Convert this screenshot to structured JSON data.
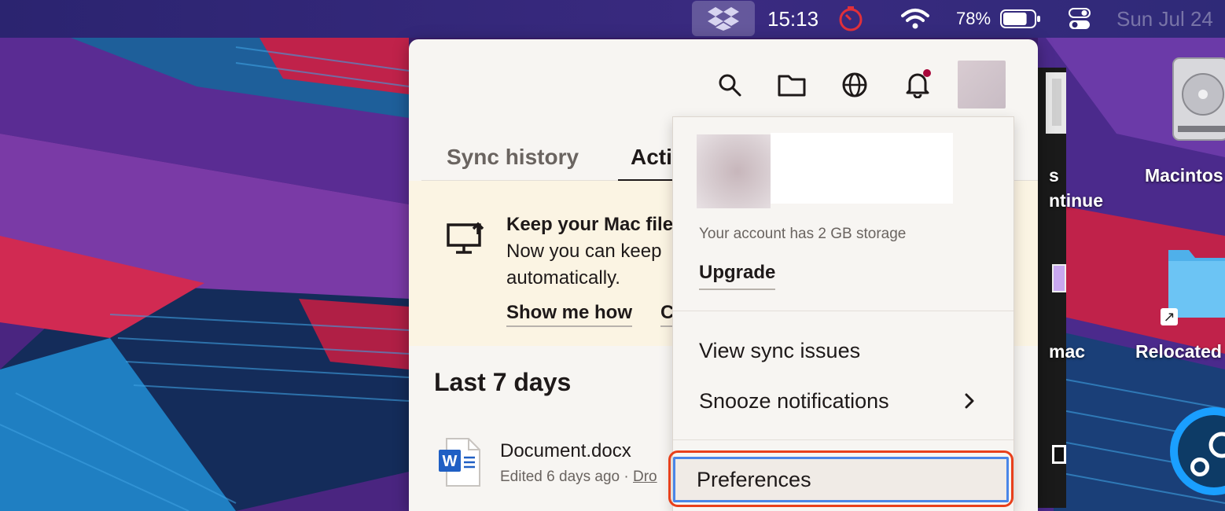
{
  "menubar": {
    "time": "15:13",
    "battery_percent": "78%",
    "date": "Sun Jul 24",
    "battery_level": 0.78
  },
  "desktop": {
    "icons": [
      {
        "label": "Macintos"
      },
      {
        "label": "Relocated"
      },
      {
        "label": "s"
      },
      {
        "label": "ntinue"
      },
      {
        "label": "mac"
      }
    ]
  },
  "popover": {
    "tabs": [
      {
        "label": "Sync history"
      },
      {
        "label": "Acti"
      }
    ],
    "banner": {
      "title": "Keep your Mac file",
      "line1": "Now you can keep",
      "line2": "automatically.",
      "link_show": "Show me how",
      "link_other": "C"
    },
    "section_title": "Last 7 days",
    "file": {
      "name": "Document.docx",
      "meta": "Edited 6 days ago · ",
      "meta_link": "Dro"
    }
  },
  "account_menu": {
    "storage_text": "Your account has 2 GB storage",
    "upgrade_label": "Upgrade",
    "items": [
      {
        "label": "View sync issues"
      },
      {
        "label": "Snooze notifications"
      },
      {
        "label": "Preferences"
      }
    ]
  },
  "colors": {
    "notification_dot": "#a8063a",
    "highlight_outline": "#e8401c",
    "focus_ring": "#4a86e8"
  }
}
